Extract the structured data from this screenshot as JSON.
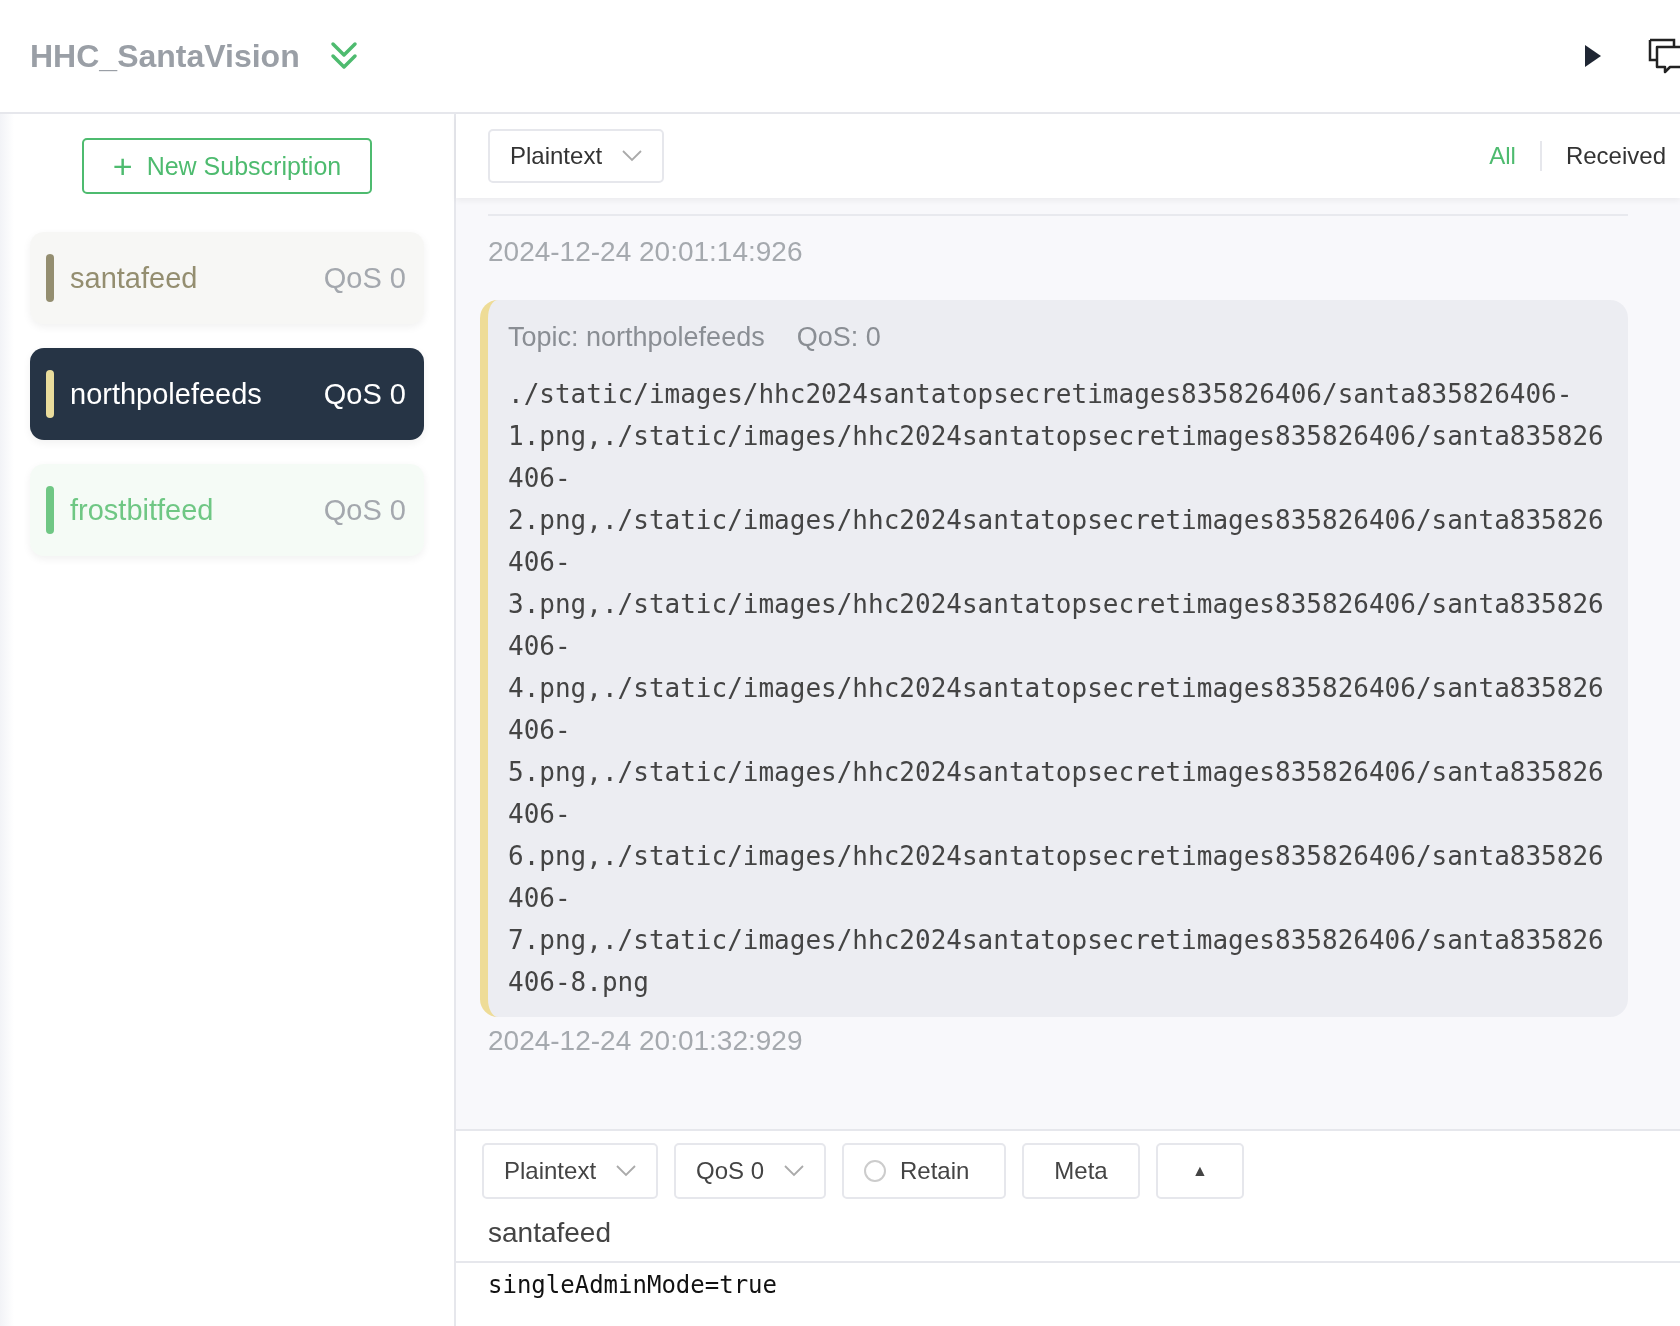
{
  "header": {
    "title": "HHC_SantaVision"
  },
  "sidebar": {
    "new_button": {
      "icon": "+",
      "label": "New Subscription"
    },
    "subscriptions": [
      {
        "name": "santafeed",
        "qos": "QoS 0",
        "color": "#948e70",
        "selected": false
      },
      {
        "name": "northpolefeeds",
        "qos": "QoS 0",
        "color": "#e9dc9c",
        "selected": true
      },
      {
        "name": "frostbitfeed",
        "qos": "QoS 0",
        "color": "#6fc784",
        "selected": false
      }
    ]
  },
  "toolbar": {
    "format": "Plaintext",
    "filters": [
      {
        "label": "All",
        "selected": true
      },
      {
        "label": "Received",
        "selected": false
      }
    ]
  },
  "messages": [
    {
      "kind": "time",
      "text": "2024-12-24 20:01:14:926"
    },
    {
      "kind": "bubble",
      "topic": "Topic: northpolefeeds",
      "qos": "QoS: 0",
      "payload": "./static/images/hhc2024santatopsecretimages835826406/santa835826406-1.png,./static/images/hhc2024santatopsecretimages835826406/santa835826406-2.png,./static/images/hhc2024santatopsecretimages835826406/santa835826406-3.png,./static/images/hhc2024santatopsecretimages835826406/santa835826406-4.png,./static/images/hhc2024santatopsecretimages835826406/santa835826406-5.png,./static/images/hhc2024santatopsecretimages835826406/santa835826406-6.png,./static/images/hhc2024santatopsecretimages835826406/santa835826406-7.png,./static/images/hhc2024santatopsecretimages835826406/santa835826406-8.png"
    },
    {
      "kind": "time",
      "text": "2024-12-24 20:01:32:929"
    }
  ],
  "publish": {
    "format": "Plaintext",
    "qos": "QoS 0",
    "retain": {
      "label": "Retain",
      "checked": false
    },
    "meta": "Meta",
    "expand": "▲",
    "topic": "santafeed",
    "payload": "singleAdminMode=true"
  }
}
